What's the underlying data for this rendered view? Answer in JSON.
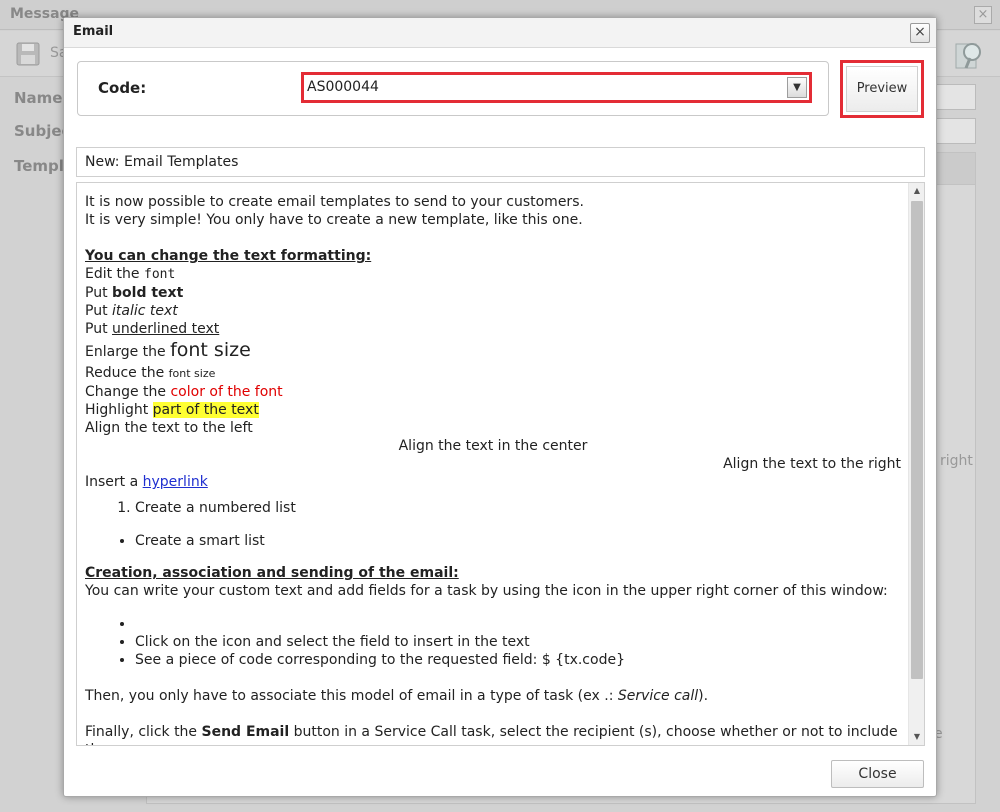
{
  "background": {
    "title": "Message",
    "close_glyph": "×",
    "save_label": "Sa",
    "fields": {
      "name_label": "Name:",
      "subject_label": "Subjec",
      "template_label": "Templa"
    },
    "overflow_text_right": "right",
    "overflow_text_e": "e"
  },
  "modal": {
    "title": "Email",
    "close_glyph": "×",
    "code_label": "Code:",
    "code_value": "AS000044",
    "dropdown_arrow": "▼",
    "preview_label": "Preview",
    "subject_value": "New: Email Templates",
    "close_button_label": "Close",
    "scroll_up": "▲",
    "scroll_down": "▼"
  },
  "email_body": {
    "intro_1": "It is now possible to create email templates to send to your customers.",
    "intro_2": "It is very simple! You only have to create a new template, like this one.",
    "heading_formatting": "You can change the text formatting:",
    "font_prefix": "Edit the ",
    "font_word": "font",
    "bold_prefix": "Put ",
    "bold_text": "bold text",
    "italic_prefix": "Put ",
    "italic_text": "italic text",
    "underline_prefix": "Put ",
    "underline_text": "underlined text",
    "enlarge_prefix": "Enlarge the ",
    "enlarge_text": "font size",
    "reduce_prefix": "Reduce the ",
    "reduce_text": "font size",
    "color_prefix": "Change the ",
    "color_text": "color of the font",
    "highlight_prefix": "Highlight ",
    "highlight_text": "part of the text",
    "align_left": "Align the text to the left",
    "align_center": "Align the text in the center",
    "align_right": "Align the text to the right",
    "hyperlink_prefix": "Insert a ",
    "hyperlink_text": "hyperlink",
    "numbered_item": "Create a numbered list",
    "smart_item": "Create a smart list",
    "heading_creation": "Creation, association and sending of the email:",
    "custom_text": "You can write your custom text and add fields for a task by using the icon in the upper right corner of this window:",
    "bullet_empty": "",
    "bullet_click": "Click on the icon and select the field to insert in the text",
    "bullet_code": "See a piece of code corresponding to the requested field: $ {tx.code}",
    "associate_prefix": "Then, you only have to associate this model of email in a type of task (ex .: ",
    "associate_italic": "Service call",
    "associate_suffix": ").",
    "finally_prefix": "Finally, click the ",
    "finally_bold": "Send Email",
    "finally_suffix": " button in a Service Call task, select the recipient (s), choose whether or not to include the"
  },
  "colors": {
    "highlight_border": "#e32c35",
    "link": "#1f2fd0",
    "red_text": "#e00000",
    "highlight_bg": "#ffff33"
  }
}
